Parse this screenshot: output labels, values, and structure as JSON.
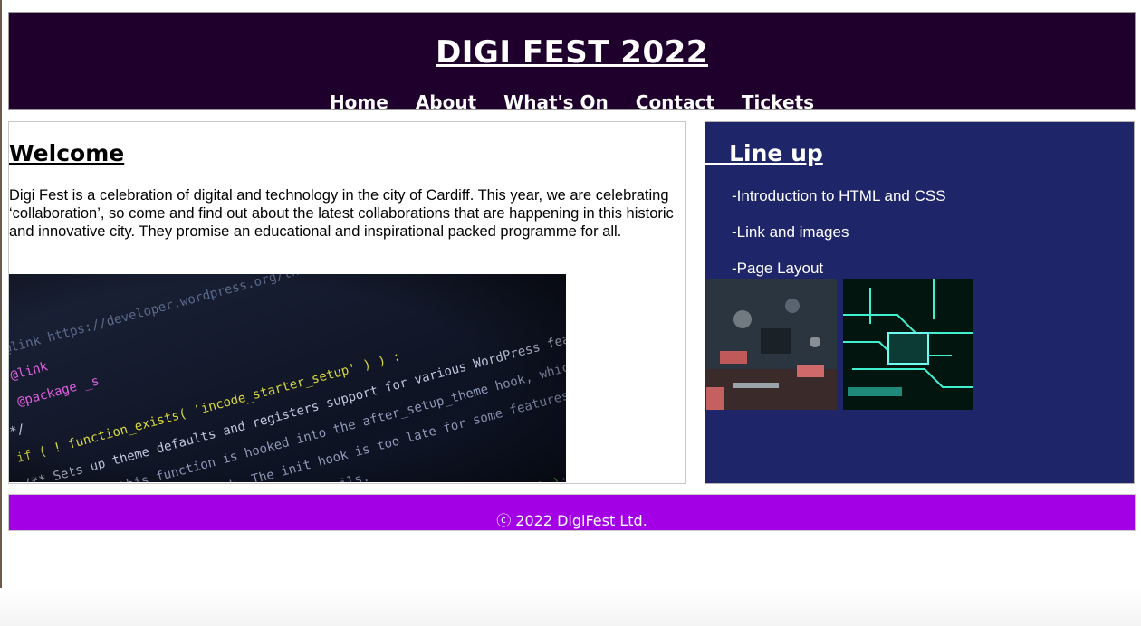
{
  "header": {
    "title": "DIGI FEST 2022",
    "nav": [
      "Home",
      "About",
      "What's On",
      "Contact",
      "Tickets"
    ]
  },
  "main": {
    "heading": "Welcome",
    "intro": "Digi Fest is a celebration of digital and technology in the city of Cardiff. This year, we are celebrating ‘collaboration’, so come and find out about the latest collaborations that are happening in this historic and innovative city. They promise an educational and inspirational packed programme for all.",
    "image_icon": "code-screenshot-photo"
  },
  "sidebar": {
    "heading": "   Line up",
    "items": [
      "-Introduction to HTML and CSS",
      "-Link and images",
      "-Page Layout"
    ],
    "photos": [
      "circuit-board-photo",
      "neon-circuit-photo"
    ]
  },
  "footer": {
    "text": "ⓒ 2022 DigiFest Ltd."
  },
  "colors": {
    "header_bg": "#1f002c",
    "sidebar_bg": "#1e2569",
    "footer_bg": "#a300e6"
  }
}
